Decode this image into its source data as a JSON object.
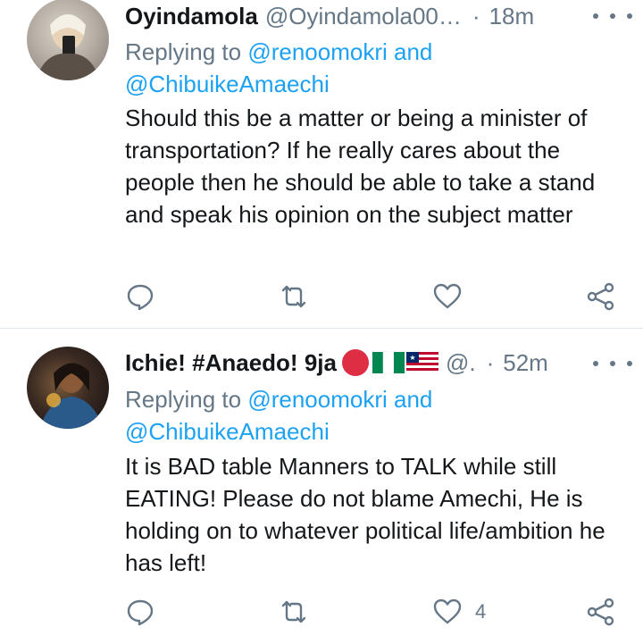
{
  "tweets": [
    {
      "name": "Oyindamola",
      "handle": "@Oyindamola00…",
      "time": "18m",
      "replying_prefix": "Replying to",
      "mention1": "@renoomokri",
      "and": "and",
      "mention2": "@ChibuikeAmaechi",
      "text": "Should this be a matter or being a minister of transportation? If he really cares about the people then he should be able to take a stand and speak his opinion on the subject matter",
      "like_count": ""
    },
    {
      "name": "Ichie! #Anaedo! 9ja",
      "handle": "@.",
      "time": "52m",
      "replying_prefix": "Replying to",
      "mention1": "@renoomokri",
      "and": "and",
      "mention2": "@ChibuikeAmaechi",
      "text": "It is BAD table Manners to TALK while still EATING! Please do not blame Amechi, He is holding on to whatever political life/ambition he has left!",
      "like_count": "4"
    }
  ],
  "colors": {
    "accent": "#1da1f2",
    "muted": "#657786",
    "text": "#14171a",
    "divider": "#e1e8ed"
  },
  "icons": [
    "reply-icon",
    "retweet-icon",
    "like-icon",
    "share-icon",
    "more-icon"
  ]
}
